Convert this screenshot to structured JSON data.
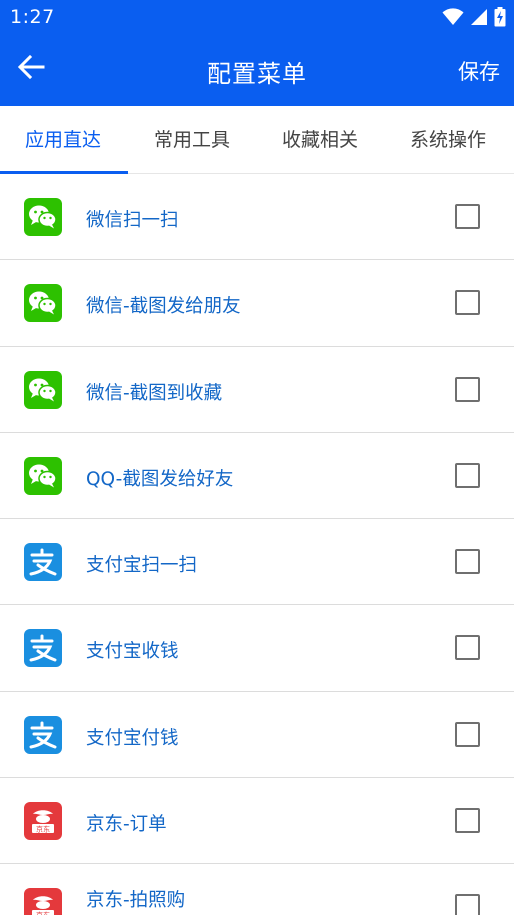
{
  "status_bar": {
    "time": "1:27",
    "icons": [
      "wifi-icon",
      "signal-icon",
      "battery-charging-icon"
    ]
  },
  "app_bar": {
    "title": "配置菜单",
    "back_icon": "arrow-left-icon",
    "save_label": "保存"
  },
  "tabs": [
    {
      "label": "应用直达",
      "active": true
    },
    {
      "label": "常用工具",
      "active": false
    },
    {
      "label": "收藏相关",
      "active": false
    },
    {
      "label": "系统操作",
      "active": false
    }
  ],
  "items": [
    {
      "label": "微信扫一扫",
      "icon": "wechat-icon",
      "checked": false
    },
    {
      "label": "微信-截图发给朋友",
      "icon": "wechat-icon",
      "checked": false
    },
    {
      "label": "微信-截图到收藏",
      "icon": "wechat-icon",
      "checked": false
    },
    {
      "label": "QQ-截图发给好友",
      "icon": "wechat-icon",
      "checked": false
    },
    {
      "label": "支付宝扫一扫",
      "icon": "alipay-icon",
      "checked": false
    },
    {
      "label": "支付宝收钱",
      "icon": "alipay-icon",
      "checked": false
    },
    {
      "label": "支付宝付钱",
      "icon": "alipay-icon",
      "checked": false
    },
    {
      "label": "京东-订单",
      "icon": "jd-icon",
      "icon_text": "京东",
      "checked": false
    },
    {
      "label": "京东-拍照购",
      "icon": "jd-icon",
      "icon_text": "京东",
      "checked": false
    }
  ],
  "colors": {
    "primary": "#0a5ef0",
    "label_text": "#1367c7",
    "wechat": "#2dc100",
    "alipay": "#1a8fe0",
    "jd": "#e4393c"
  }
}
